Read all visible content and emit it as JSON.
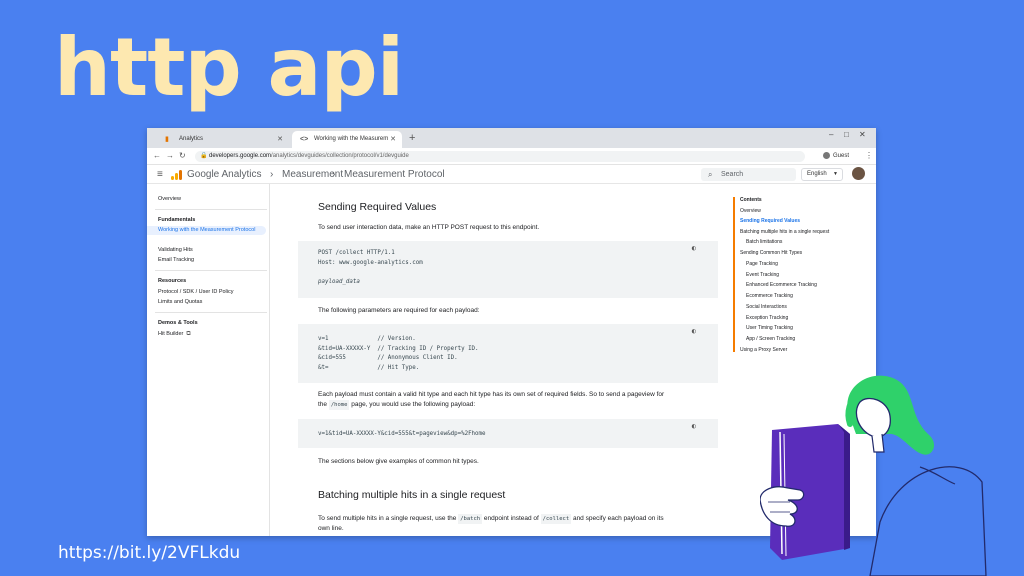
{
  "slide": {
    "title": "http api",
    "short_url": "https://bit.ly/2VFLkdu"
  },
  "browser": {
    "tabs": [
      {
        "label": "Analytics",
        "close": "✕"
      },
      {
        "label": "Working with the Measurem",
        "close": "✕"
      }
    ],
    "new_tab": "+",
    "url_host": "developers.google.com",
    "url_path": "/analytics/devguides/collection/protocol/v1/devguide",
    "profile_label": "Guest"
  },
  "site": {
    "brand": "Google Analytics",
    "breadcrumbs": [
      "Measurement",
      "Measurement Protocol"
    ],
    "search_placeholder": "Search",
    "language": "English"
  },
  "left_nav": [
    {
      "label": "Overview"
    },
    {
      "label": "Fundamentals",
      "heading": true
    },
    {
      "label": "Working with the Measurement Protocol",
      "active": true
    },
    {
      "label": "Validating Hits"
    },
    {
      "label": "Email Tracking"
    },
    {
      "label": "Resources",
      "heading": true
    },
    {
      "label": "Protocol / SDK / User ID Policy"
    },
    {
      "label": "Limits and Quotas"
    },
    {
      "label": "Demos & Tools",
      "heading": true
    },
    {
      "label": "Hit Builder"
    }
  ],
  "content": {
    "h1": "Sending Required Values",
    "p1": "To send user interaction data, make an HTTP POST request to this endpoint.",
    "code1": [
      "POST /collect HTTP/1.1",
      "Host: www.google-analytics.com",
      "",
      "payload_data"
    ],
    "p2": "The following parameters are required for each payload:",
    "code2": [
      "v=1              // Version.",
      "&tid=UA-XXXXX-Y  // Tracking ID / Property ID.",
      "&cid=555         // Anonymous Client ID.",
      "&t=              // Hit Type."
    ],
    "p3a": "Each payload must contain a valid hit type and each hit type has its own set of required fields. So to send a pageview for",
    "p3b_pre": "the",
    "p3b_code": "/home",
    "p3b_post": "page, you would use the following payload:",
    "code3": [
      "v=1&tid=UA-XXXXX-Y&cid=555&t=pageview&dp=%2Fhome"
    ],
    "p4": "The sections below give examples of common hit types.",
    "h2": "Batching multiple hits in a single request",
    "p5_pre": "To send multiple hits in a single request, use the",
    "p5_code1": "/batch",
    "p5_mid": "endpoint instead of",
    "p5_code2": "/collect",
    "p5_post": "and specify each payload on its",
    "p5_line2": "own line."
  },
  "toc": [
    {
      "label": "Contents",
      "style": "bold"
    },
    {
      "label": "Overview"
    },
    {
      "label": "Sending Required Values",
      "style": "active"
    },
    {
      "label": "Batching multiple hits in a single request"
    },
    {
      "label": "Batch limitations",
      "sub": true
    },
    {
      "label": "Sending Common Hit Types"
    },
    {
      "label": "Page Tracking",
      "sub": true
    },
    {
      "label": "Event Tracking",
      "sub": true
    },
    {
      "label": "Enhanced Ecommerce Tracking",
      "sub": true
    },
    {
      "label": "Ecommerce Tracking",
      "sub": true
    },
    {
      "label": "Social Interactions",
      "sub": true
    },
    {
      "label": "Exception Tracking",
      "sub": true
    },
    {
      "label": "User Timing Tracking",
      "sub": true
    },
    {
      "label": "App / Screen Tracking",
      "sub": true
    },
    {
      "label": "Using a Proxy Server"
    }
  ],
  "colors": {
    "background": "#4a80f0",
    "title": "#fde8b0",
    "toc_accent": "#f57c00",
    "link": "#1a73e8"
  }
}
